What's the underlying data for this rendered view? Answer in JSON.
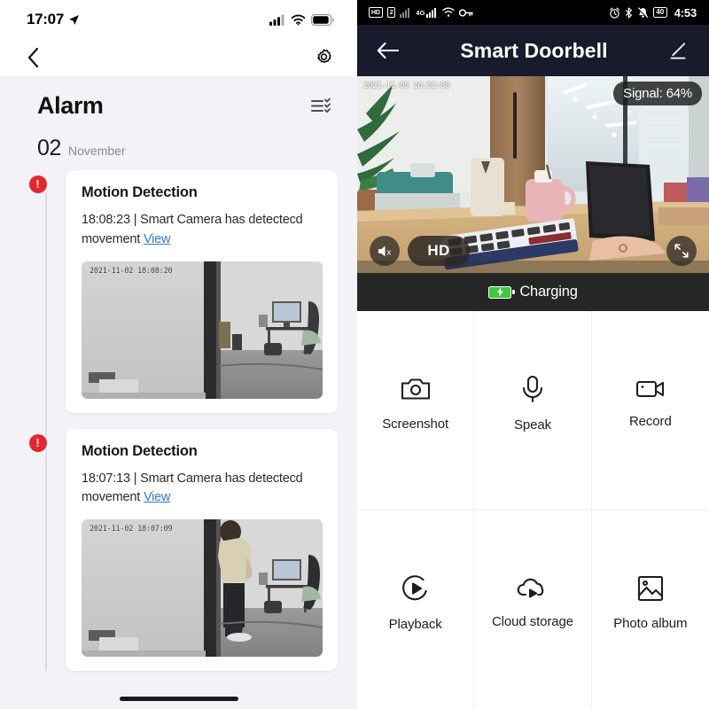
{
  "left": {
    "status_bar": {
      "time": "17:07",
      "location_icon": "location-arrow-icon",
      "cellular_icon": "cellular-bars-icon",
      "wifi_icon": "wifi-icon",
      "battery_icon": "battery-icon"
    },
    "nav": {
      "back_icon": "chevron-left-icon",
      "settings_icon": "gear-icon"
    },
    "page_title": "Alarm",
    "filter_icon": "checklist-filter-icon",
    "date": {
      "day": "02",
      "month": "November"
    },
    "events": [
      {
        "badge_icon": "alert-exclamation-icon",
        "badge_char": "!",
        "heading": "Motion Detection",
        "time": "18:08:23",
        "separator": "|",
        "message": "Smart Camera has detectecd movement",
        "link_label": "View",
        "thumbnail_timestamp": "2021-11-02 18:08:20"
      },
      {
        "badge_icon": "alert-exclamation-icon",
        "badge_char": "!",
        "heading": "Motion Detection",
        "time": "18:07:13",
        "separator": "|",
        "message": "Smart Camera has detectecd movement",
        "link_label": "View",
        "thumbnail_timestamp": "2021-11-02 18:07:09"
      }
    ],
    "home_indicator": "home-indicator"
  },
  "right": {
    "status_bar": {
      "hd_badge": "HD",
      "dual_sim_badge": "2",
      "signal1_icon": "signal-bars-weak-icon",
      "network_label": "4G",
      "signal2_icon": "signal-bars-icon",
      "wifi_icon": "wifi-icon",
      "vpn_icon": "vpn-key-icon",
      "alarm_icon": "alarm-clock-icon",
      "bluetooth_icon": "bluetooth-icon",
      "mute_icon": "bell-muted-icon",
      "battery_level": "40",
      "time": "4:53"
    },
    "titlebar": {
      "back_icon": "arrow-left-icon",
      "title": "Smart Doorbell",
      "edit_icon": "pencil-edit-icon"
    },
    "video": {
      "timestamp": "2021-11-05 16:52:08",
      "signal_label": "Signal: 64%",
      "mute_icon": "speaker-muted-icon",
      "quality_label": "HD",
      "fullscreen_icon": "fullscreen-expand-icon"
    },
    "charging": {
      "battery_icon": "battery-charging-icon",
      "label": "Charging",
      "color": "#3cc840"
    },
    "actions": [
      {
        "icon": "camera-icon",
        "label": "Screenshot"
      },
      {
        "icon": "microphone-icon",
        "label": "Speak"
      },
      {
        "icon": "video-camera-icon",
        "label": "Record"
      },
      {
        "icon": "play-circle-icon",
        "label": "Playback"
      },
      {
        "icon": "cloud-play-icon",
        "label": "Cloud storage"
      },
      {
        "icon": "image-frame-icon",
        "label": "Photo album"
      }
    ]
  },
  "colors": {
    "alert_red": "#e8252c",
    "link_blue": "#3478c8",
    "android_header": "#171b2c",
    "charging_green": "#3cc840",
    "list_bg": "#f3f3f7"
  }
}
